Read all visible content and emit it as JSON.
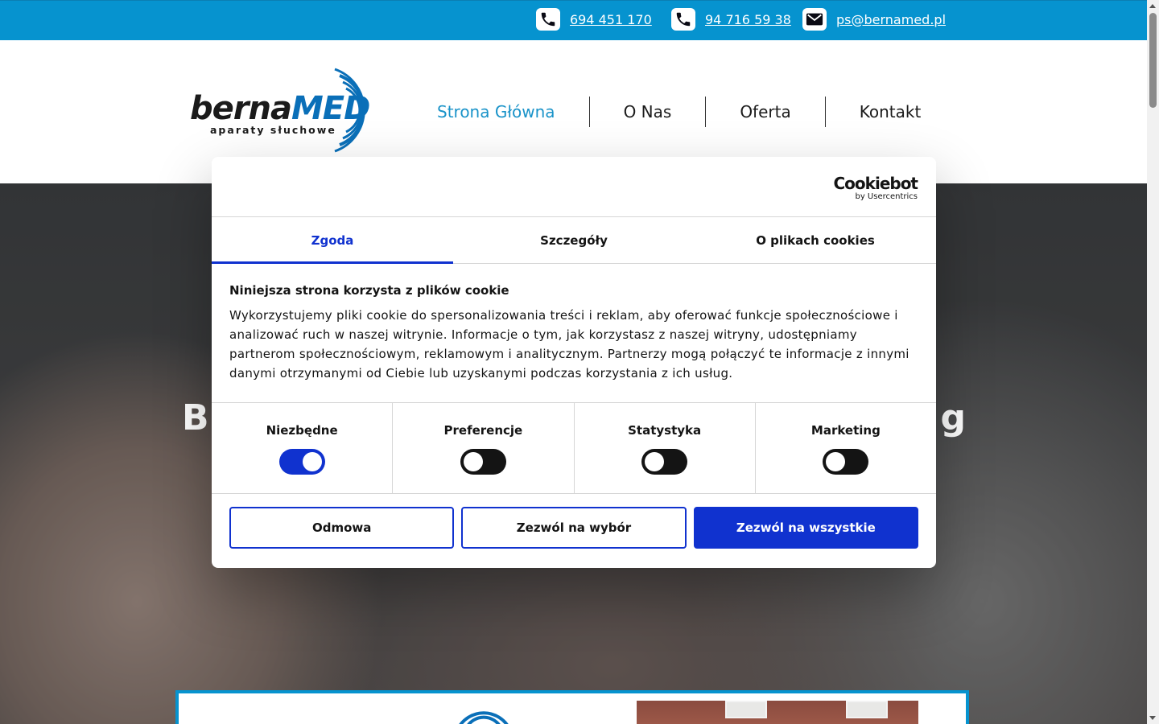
{
  "topbar": {
    "phone1": "694 451 170",
    "phone2": "94 716 59 38",
    "email": "ps@bernamed.pl",
    "icons": [
      "phone-icon",
      "phone-icon",
      "mail-icon"
    ]
  },
  "logo": {
    "part1": "berna",
    "part2": "MED",
    "tagline": "aparaty słuchowe"
  },
  "nav": [
    "Strona Główna",
    "O Nas",
    "Oferta",
    "Kontakt"
  ],
  "hero": {
    "title_left": "B",
    "title_right": "g"
  },
  "cookie_dialog": {
    "brand": "Cookiebot",
    "brand_by": "by Usercentrics",
    "tabs": [
      "Zgoda",
      "Szczegóły",
      "O plikach cookies"
    ],
    "active_tab": "Zgoda",
    "heading": "Niniejsza strona korzysta z plików cookie",
    "text": "Wykorzystujemy pliki cookie do spersonalizowania treści i reklam, aby oferować funkcje społecznościowe i analizować ruch w naszej witrynie. Informacje o tym, jak korzystasz z naszej witryny, udostępniamy partnerom społecznościowym, reklamowym i analitycznym. Partnerzy mogą połączyć te informacje z innymi danymi otrzymanymi od Ciebie lub uzyskanymi podczas korzystania z ich usług.",
    "toggles": [
      {
        "label": "Niezbędne",
        "on": true
      },
      {
        "label": "Preferencje",
        "on": false
      },
      {
        "label": "Statystyka",
        "on": false
      },
      {
        "label": "Marketing",
        "on": false
      }
    ],
    "buttons": {
      "deny": "Odmowa",
      "allow_selection": "Zezwól na wybór",
      "allow_all": "Zezwól na wszystkie"
    }
  },
  "colors": {
    "brand_blue": "#0693cf",
    "accent": "#1032cf",
    "nav_active": "#1a93c9"
  }
}
